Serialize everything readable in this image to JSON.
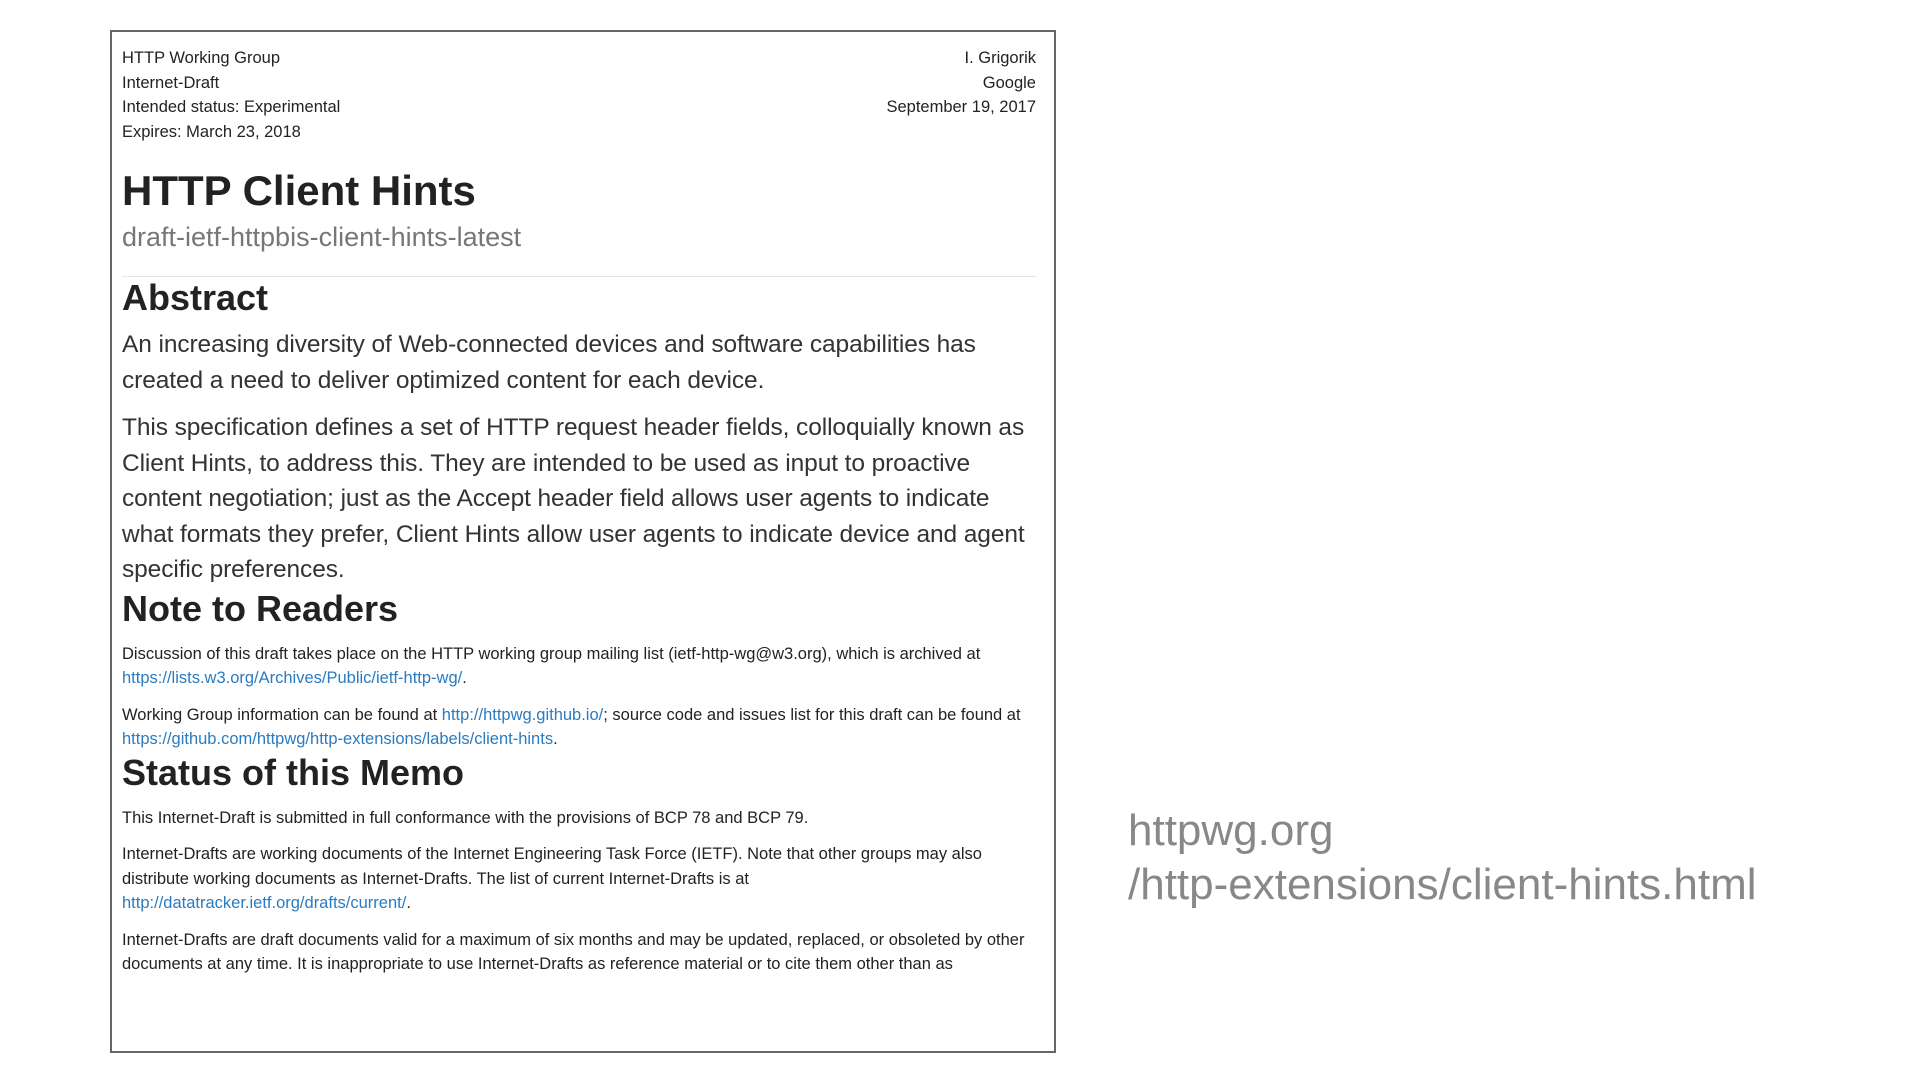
{
  "header": {
    "left": [
      "HTTP Working Group",
      "Internet-Draft",
      "Intended status: Experimental",
      "Expires: March 23, 2018"
    ],
    "right": [
      "I. Grigorik",
      "Google",
      "September 19, 2017"
    ]
  },
  "title": "HTTP Client Hints",
  "subtitle": "draft-ietf-httpbis-client-hints-latest",
  "abstract": {
    "heading": "Abstract",
    "p1": "An increasing diversity of Web-connected devices and software capabilities has created a need to deliver optimized content for each device.",
    "p2": "This specification defines a set of HTTP request header fields, colloquially known as Client Hints, to address this. They are intended to be used as input to proactive content negotiation; just as the Accept header field allows user agents to indicate what formats they prefer, Client Hints allow user agents to indicate device and agent specific preferences."
  },
  "note": {
    "heading": "Note to Readers",
    "p1_text": "Discussion of this draft takes place on the HTTP working group mailing list (ietf-http-wg@w3.org), which is archived at ",
    "p1_link": "https://lists.w3.org/Archives/Public/ietf-http-wg/",
    "p1_end": ".",
    "p2_text": "Working Group information can be found at ",
    "p2_link1": "http://httpwg.github.io/",
    "p2_mid": "; source code and issues list for this draft can be found at ",
    "p2_link2": "https://github.com/httpwg/http-extensions/labels/client-hints",
    "p2_end": "."
  },
  "status": {
    "heading": "Status of this Memo",
    "p1": "This Internet-Draft is submitted in full conformance with the provisions of BCP 78 and BCP 79.",
    "p2_text": "Internet-Drafts are working documents of the Internet Engineering Task Force (IETF). Note that other groups may also distribute working documents as Internet-Drafts. The list of current Internet-Drafts is at ",
    "p2_link": "http://datatracker.ietf.org/drafts/current/",
    "p2_end": ".",
    "p3": "Internet-Drafts are draft documents valid for a maximum of six months and may be updated, replaced, or obsoleted by other documents at any time. It is inappropriate to use Internet-Drafts as reference material or to cite them other than as"
  },
  "side_url": {
    "line1": "httpwg.org",
    "line2": "/http-extensions/client-hints.html"
  }
}
